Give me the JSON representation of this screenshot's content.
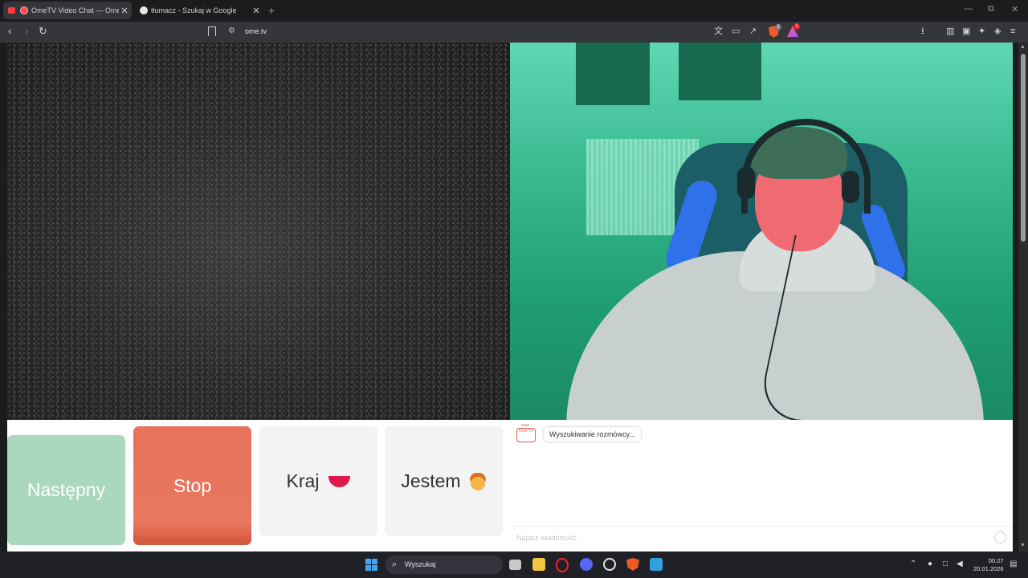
{
  "browser": {
    "tabs": [
      {
        "title": "OmeTV Video Chat — Omeg",
        "active": true
      },
      {
        "title": "tłumacz - Szukaj w Google",
        "active": false
      }
    ],
    "new_tab_symbol": "+",
    "close_symbol": "✕",
    "url": "ome.tv",
    "extension_badges": {
      "brave_shields": "2",
      "rewards": "1"
    },
    "window_controls": [
      "—",
      "⧉",
      "✕"
    ]
  },
  "controls": {
    "next_label": "Następny",
    "stop_label": "Stop",
    "country_label": "Kraj",
    "gender_label": "Jestem"
  },
  "chat": {
    "bot_avatar_text": "Ome TV",
    "status_message": "Wyszukiwanie rozmówcy...",
    "input_placeholder": "Napisz wiadomość"
  },
  "taskbar": {
    "search_label": "Wyszukaj",
    "time": "00:27",
    "date": "20.01.2026"
  },
  "colors": {
    "next_button": "#a9d8bd",
    "stop_button": "#e8725c",
    "neutral_button": "#f3f3f3",
    "brand_accent": "#e55c4d"
  },
  "icons": [
    "back-icon",
    "forward-icon",
    "reload-icon",
    "bookmark-icon",
    "site-settings-icon",
    "translate-icon",
    "cast-icon",
    "share-icon",
    "brave-shields-icon",
    "brave-rewards-icon",
    "sidebar-icon",
    "wallet-icon",
    "leo-icon",
    "vpn-icon",
    "menu-icon",
    "windows-start-icon",
    "search-icon",
    "emoji-icon"
  ]
}
